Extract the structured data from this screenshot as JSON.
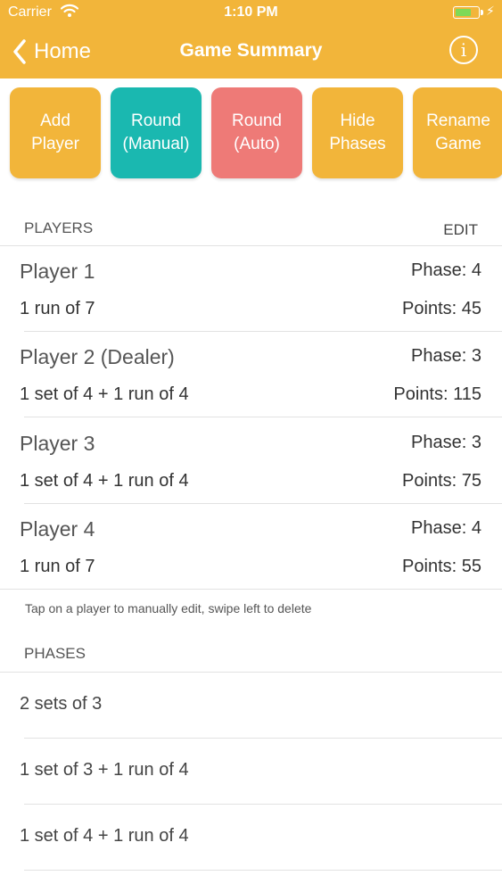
{
  "status_bar": {
    "carrier": "Carrier",
    "time": "1:10 PM",
    "wifi_icon": "wifi-icon",
    "battery_icon": "battery-icon",
    "battery_color": "#7ed957"
  },
  "nav": {
    "back_label": "Home",
    "title": "Game Summary",
    "info_glyph": "i",
    "background": "#f2b53a"
  },
  "actions": [
    {
      "line1": "Add",
      "line2": "Player",
      "color": "#f2b53a"
    },
    {
      "line1": "Round",
      "line2": "(Manual)",
      "color": "#1ab8b0"
    },
    {
      "line1": "Round",
      "line2": "(Auto)",
      "color": "#ee7a77"
    },
    {
      "line1": "Hide",
      "line2": "Phases",
      "color": "#f2b53a"
    },
    {
      "line1": "Rename",
      "line2": "Game",
      "color": "#f2b53a"
    }
  ],
  "players_section": {
    "header": "PLAYERS",
    "edit_label": "EDIT",
    "footnote": "Tap on a player to manually edit, swipe left to delete"
  },
  "players": [
    {
      "name": "Player 1",
      "phase": "Phase: 4",
      "requirement": "1 run of 7",
      "points": "Points: 45"
    },
    {
      "name": "Player 2 (Dealer)",
      "phase": "Phase: 3",
      "requirement": "1 set of 4 + 1 run of 4",
      "points": "Points: 115"
    },
    {
      "name": "Player 3",
      "phase": "Phase: 3",
      "requirement": "1 set of 4 + 1 run of 4",
      "points": "Points: 75"
    },
    {
      "name": "Player 4",
      "phase": "Phase: 4",
      "requirement": "1 run of 7",
      "points": "Points: 55"
    }
  ],
  "phases_section": {
    "header": "PHASES"
  },
  "phases": [
    "2 sets of 3",
    "1 set of 3 + 1 run of 4",
    "1 set of 4 + 1 run of 4"
  ]
}
